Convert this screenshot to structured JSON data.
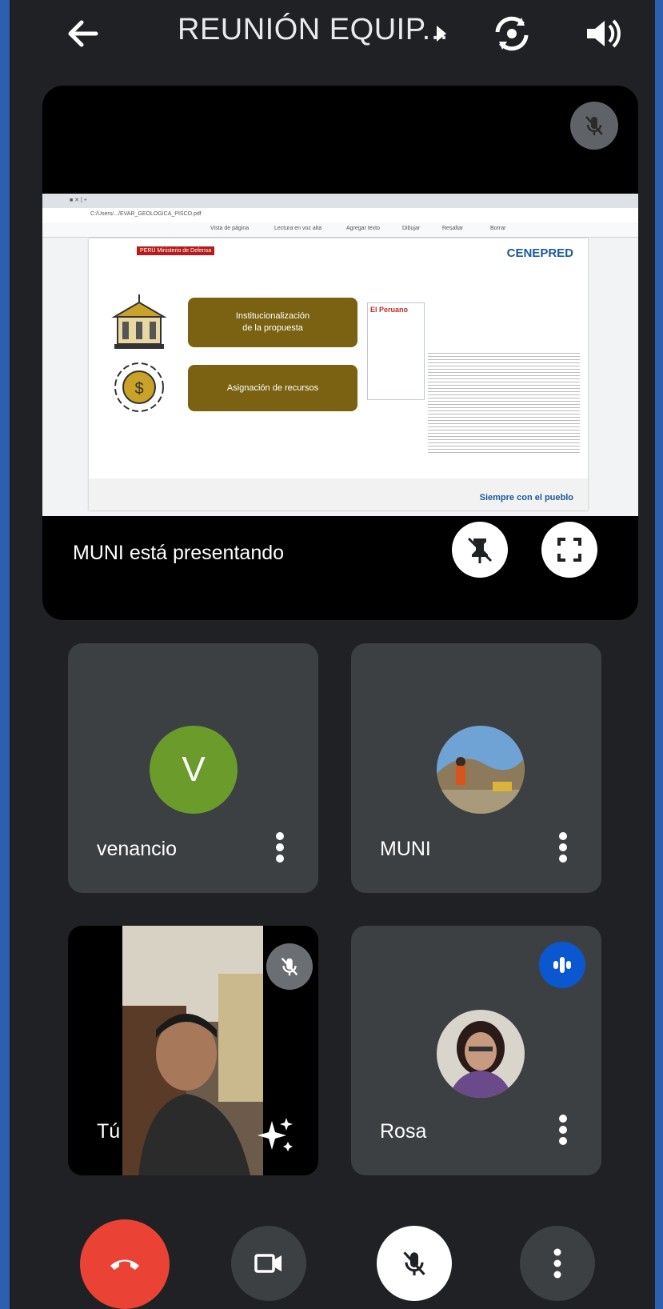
{
  "header": {
    "title": "REUNIÓN EQUIP...",
    "icons": [
      "arrow-back-icon",
      "caret-right-icon",
      "switch-camera-icon",
      "volume-icon"
    ]
  },
  "presentation": {
    "status": "MUNI está presentando",
    "slide": {
      "org_badge": "PERÚ Ministerio de Defensa",
      "logo": "CENEPRED",
      "item1_line1": "Institucionalización",
      "item1_line2": "de la  propuesta",
      "item2": "Asignación de recursos",
      "doc_title": "El Peruano",
      "footer_logo": "Siempre con el pueblo"
    },
    "browser_url": "C:/Users/.../EVAR_GEOLOGICA_PISCO.pdf",
    "browser_toolbar": [
      "Vista de página",
      "Lectura en voz alta",
      "Agregar texto",
      "Dibujar",
      "Resaltar",
      "Borrar"
    ]
  },
  "participants": [
    {
      "name": "venancio",
      "avatar_letter": "V",
      "avatar_color": "#6a9b2b"
    },
    {
      "name": "MUNI",
      "avatar": "photo"
    },
    {
      "name": "Tú",
      "video": true,
      "muted": true
    },
    {
      "name": "Rosa",
      "avatar": "photo",
      "speaking": true
    }
  ],
  "colors": {
    "background": "#1f2124",
    "tile": "#3c4043",
    "end_call": "#ea4335",
    "speaking": "#0b57d0"
  }
}
